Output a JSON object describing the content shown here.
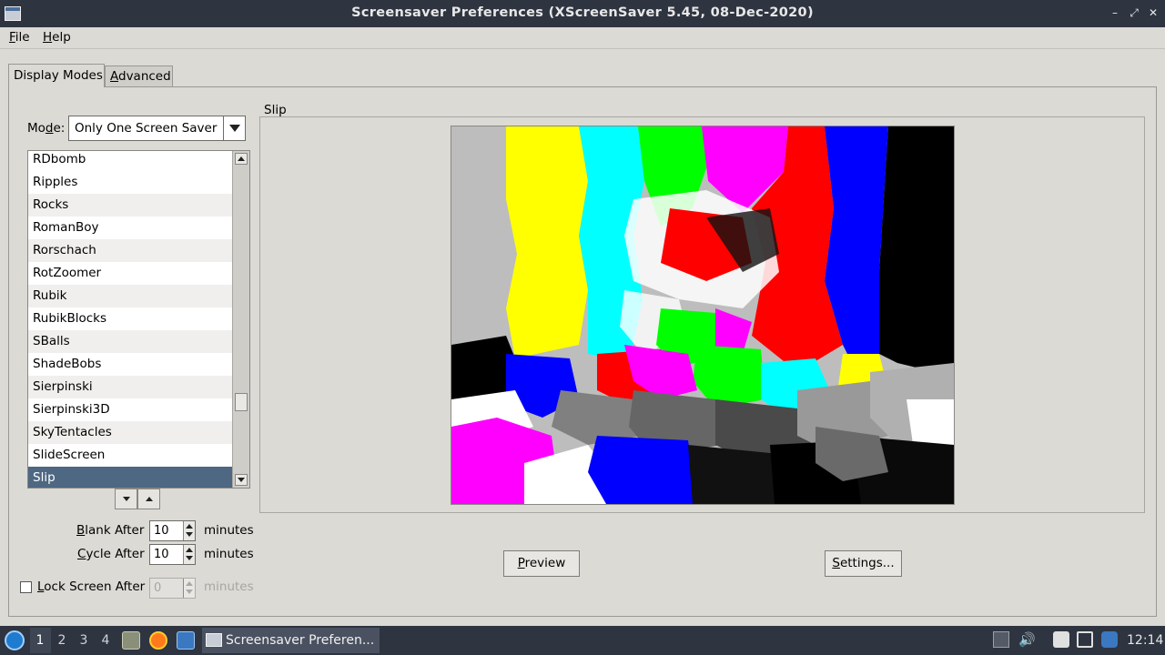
{
  "window": {
    "title": "Screensaver Preferences  (XScreenSaver 5.45, 08-Dec-2020)",
    "controls": [
      "–",
      "⤢",
      "✕"
    ]
  },
  "menubar": {
    "file": "File",
    "help": "Help"
  },
  "tabs": {
    "display_modes": "Display Modes",
    "advanced": "Advanced"
  },
  "mode": {
    "label": "Mode:",
    "value": "Only One Screen Saver"
  },
  "savers": [
    "RDbomb",
    "Ripples",
    "Rocks",
    "RomanBoy",
    "Rorschach",
    "RotZoomer",
    "Rubik",
    "RubikBlocks",
    "SBalls",
    "ShadeBobs",
    "Sierpinski",
    "Sierpinski3D",
    "SkyTentacles",
    "SlideScreen",
    "Slip"
  ],
  "selected_saver": "Slip",
  "settings": {
    "blank_after": {
      "label": "Blank After",
      "value": "10",
      "unit": "minutes"
    },
    "cycle_after": {
      "label": "Cycle After",
      "value": "10",
      "unit": "minutes"
    },
    "lock_after": {
      "label": "Lock Screen After",
      "value": "0",
      "unit": "minutes",
      "checked": false
    }
  },
  "preview": {
    "frame_title": "Slip",
    "preview_button": "Preview",
    "settings_button": "Settings..."
  },
  "taskbar": {
    "workspaces": [
      "1",
      "2",
      "3",
      "4"
    ],
    "active_workspace": "1",
    "task_label": "Screensaver Preferen...",
    "clock": "12:14"
  },
  "colors": {
    "selection": "#4e6782",
    "panel_bg": "#2e3440",
    "dialog_bg": "#dcdad5"
  }
}
